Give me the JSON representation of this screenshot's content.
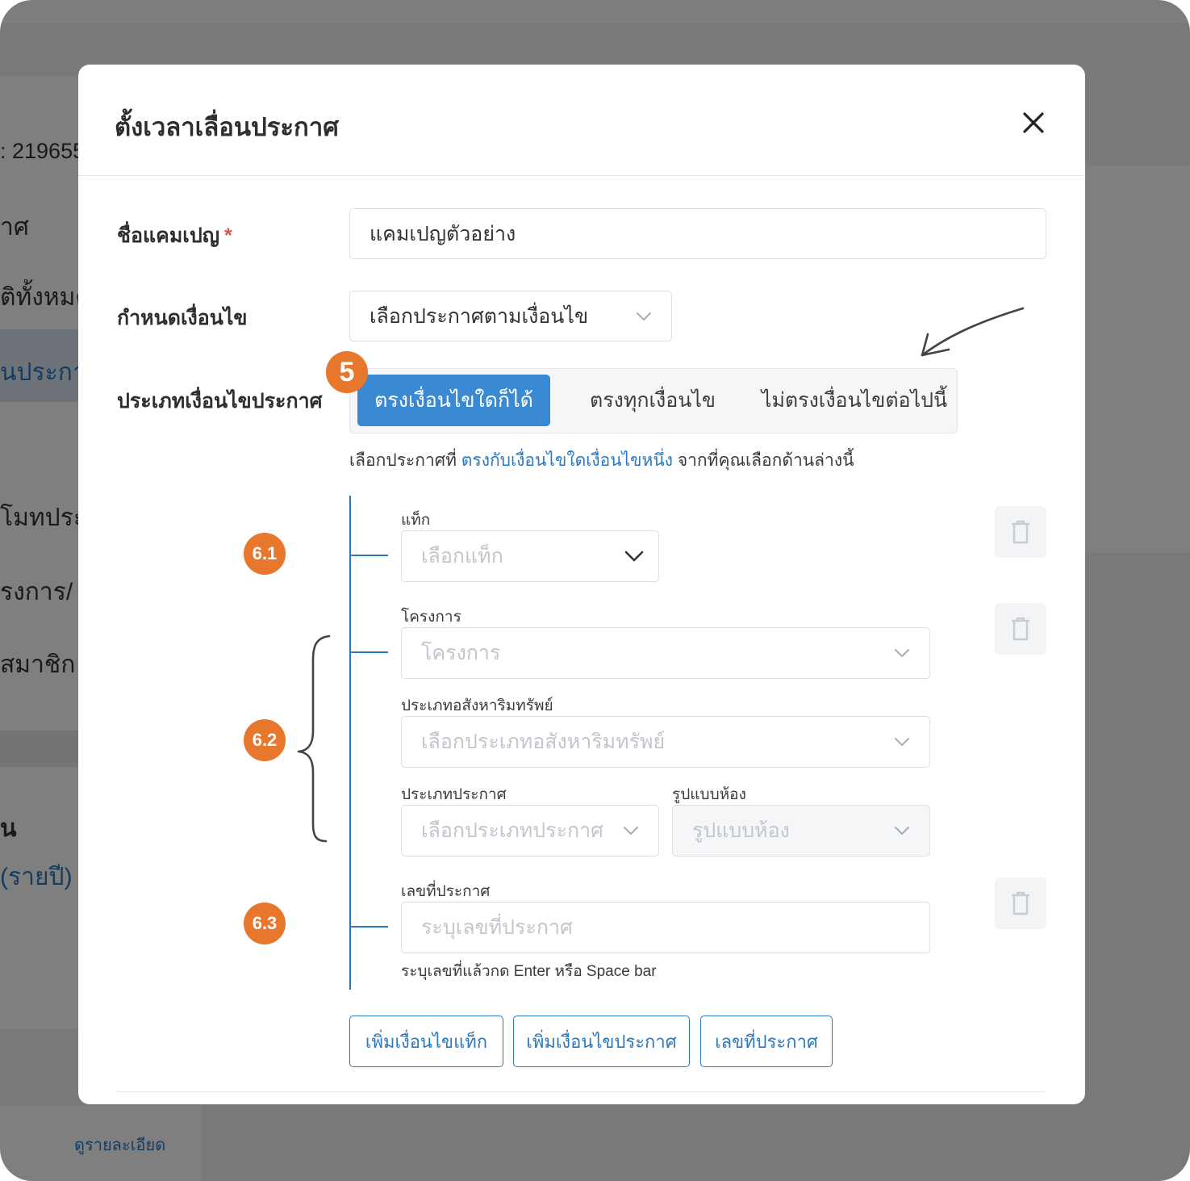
{
  "background": {
    "ref_text": ": 219655",
    "nav_items": [
      "าศ",
      "ติทั้งหมด",
      "นประกาศ",
      "โมทประกาศ",
      "รงการ/",
      "สมาชิก"
    ],
    "section_heading": "น",
    "section_link": "(รายปี)",
    "footer_link": "ดูรายละเอียด"
  },
  "modal": {
    "title": "ตั้งเวลาเลื่อนประกาศ",
    "campaign": {
      "label": "ชื่อแคมเปญ",
      "required_mark": "*",
      "value": "แคมเปญตัวอย่าง"
    },
    "condition": {
      "label": "กำหนดเงื่อนไข",
      "value": "เลือกประกาศตามเงื่อนไข"
    },
    "condition_type": {
      "label": "ประเภทเงื่อนไขประกาศ",
      "options": [
        "ตรงเงื่อนไขใดก็ได้",
        "ตรงทุกเงื่อนไข",
        "ไม่ตรงเงื่อนไขต่อไปนี้"
      ],
      "selected_index": 0
    },
    "hint": {
      "prefix": "เลือกประกาศที่ ",
      "link": "ตรงกับเงื่อนไขใดเงื่อนไขหนึ่ง",
      "suffix": " จากที่คุณเลือกด้านล่างนี้"
    },
    "tag_group": {
      "label": "แท็ก",
      "placeholder": "เลือกแท็ก"
    },
    "listing_group": {
      "project_label": "โครงการ",
      "project_placeholder": "โครงการ",
      "property_type_label": "ประเภทอสังหาริมทรัพย์",
      "property_type_placeholder": "เลือกประเภทอสังหาริมทรัพย์",
      "listing_type_label": "ประเภทประกาศ",
      "listing_type_placeholder": "เลือกประเภทประกาศ",
      "room_type_label": "รูปแบบห้อง",
      "room_type_placeholder": "รูปแบบห้อง"
    },
    "number_group": {
      "label": "เลขที่ประกาศ",
      "placeholder": "ระบุเลขที่ประกาศ",
      "help": "ระบุเลขที่แล้วกด Enter หรือ Space bar"
    },
    "add_buttons": [
      "เพิ่มเงื่อนไขแท็ก",
      "เพิ่มเงื่อนไขประกาศ",
      "เลขที่ประกาศ"
    ]
  },
  "annotations": {
    "step": "5",
    "group_markers": [
      "6.1",
      "6.2",
      "6.3"
    ]
  },
  "colors": {
    "primary": "#3a8ad3",
    "link": "#2a78bf",
    "annotation": "#e8772e",
    "overlay": "rgba(0,0,0,0.5)"
  }
}
